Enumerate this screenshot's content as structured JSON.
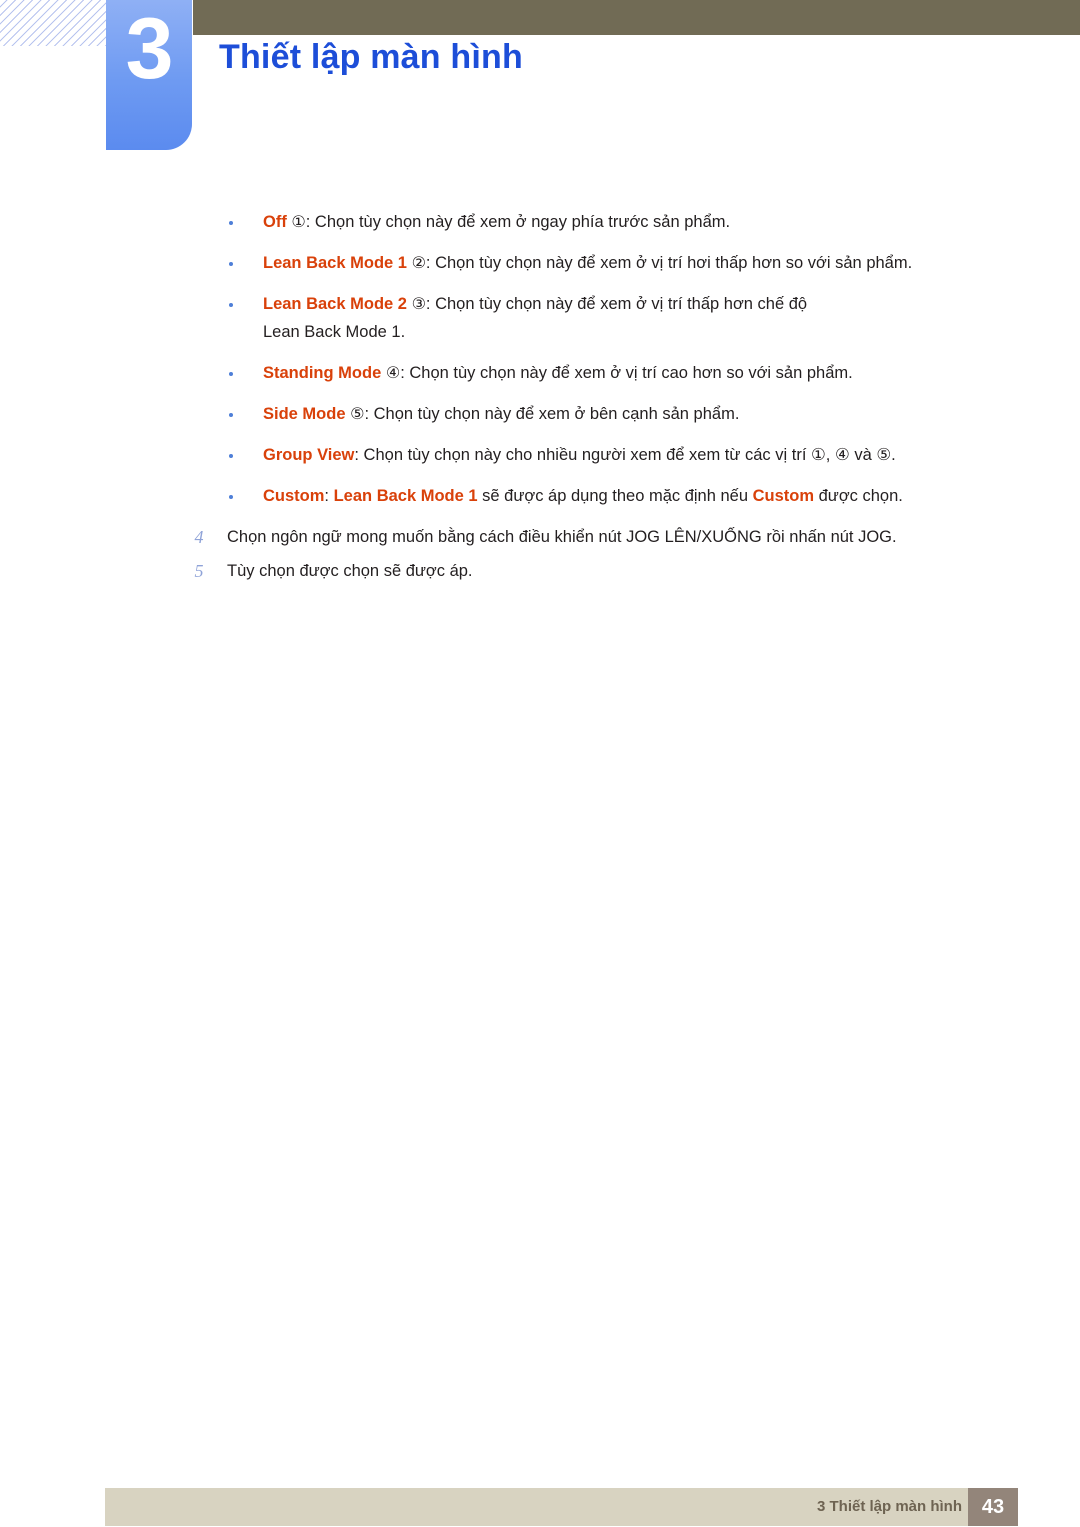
{
  "header": {
    "chapter_number": "3",
    "title": "Thiết lập màn hình",
    "title_color": "#1d4ed8",
    "tab_color": "#6f9bf2",
    "bar_color": "#716b55"
  },
  "content": {
    "bullets": [
      {
        "term": "Off",
        "circled": "①",
        "rest": ": Chọn tùy chọn này để xem ở ngay phía trước sản phẩm.",
        "continuation": ""
      },
      {
        "term": "Lean Back Mode 1",
        "circled": "②",
        "rest": ": Chọn tùy chọn này để xem ở vị trí hơi thấp hơn so với sản phẩm.",
        "continuation": ""
      },
      {
        "term": "Lean Back Mode 2",
        "circled": "③",
        "rest": ": Chọn tùy chọn này để xem ở vị trí thấp hơn chế độ",
        "continuation": "Lean Back Mode 1."
      },
      {
        "term": "Standing Mode",
        "circled": "④",
        "rest": ": Chọn tùy chọn này để xem ở vị trí cao hơn so với sản phẩm.",
        "continuation": ""
      },
      {
        "term": "Side Mode",
        "circled": "⑤",
        "rest": ": Chọn tùy chọn này để xem ở bên cạnh sản phẩm.",
        "continuation": ""
      },
      {
        "term": "Group View",
        "circled": "",
        "rest": ": Chọn tùy chọn này cho nhiều người xem để xem từ các vị trí ①, ④ và ⑤.",
        "continuation": ""
      }
    ],
    "custom_bullet": {
      "term1": "Custom",
      "sep1": ": ",
      "term2": "Lean Back Mode 1",
      "mid": " sẽ được áp dụng theo mặc định nếu ",
      "term3": "Custom",
      "tail": " được chọn."
    },
    "steps": [
      {
        "number": "4",
        "text": "Chọn ngôn ngữ mong muốn bằng cách điều khiển nút JOG LÊN/XUỐNG rồi nhấn nút JOG."
      },
      {
        "number": "5",
        "text": "Tùy chọn được chọn sẽ được áp."
      }
    ],
    "term_color": "#d9410a",
    "bullet_marker_color": "#4e7fd8",
    "step_number_color": "#8fa3d8"
  },
  "footer": {
    "text": "3 Thiết lập màn hình",
    "page_number": "43",
    "bar_color": "#d8d3c1",
    "box_color": "#93857a",
    "text_color": "#6e6352"
  }
}
